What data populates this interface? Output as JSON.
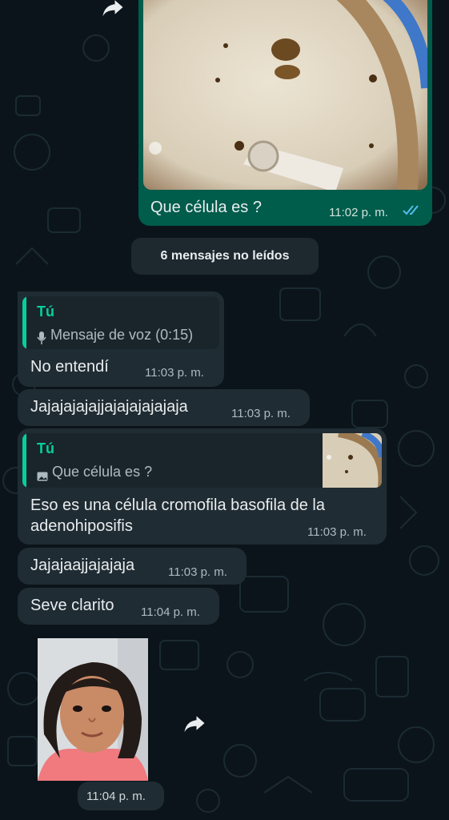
{
  "top_message": {
    "caption": "Que célula es ?",
    "time": "11:02 p. m.",
    "status_icon": "double-check-read-icon"
  },
  "unread_banner": "6 mensajes no leídos",
  "messages": [
    {
      "quote_author": "Tú",
      "quote_text": "Mensaje de voz (0:15)",
      "quote_icon": "microphone-icon",
      "text": "No entendí",
      "time": "11:03 p. m."
    },
    {
      "text": "Jajajajajajjajajajajajaja",
      "time": "11:03 p. m."
    },
    {
      "quote_author": "Tú",
      "quote_text": "Que célula es ?",
      "quote_icon": "image-icon",
      "text_line1": "Eso es una célula cromofila basofila de la",
      "text_line2": "adenohiposifis",
      "time": "11:03 p. m."
    },
    {
      "text": "Jajajaajjajajaja",
      "time": "11:03 p. m."
    },
    {
      "text": "Seve clarito",
      "time": "11:04 p. m."
    },
    {
      "type": "image",
      "time": "11:04 p. m."
    }
  ],
  "colors": {
    "background": "#0b141a",
    "incoming": "#202c33",
    "outgoing": "#005c4b",
    "accent": "#06cf9c"
  }
}
